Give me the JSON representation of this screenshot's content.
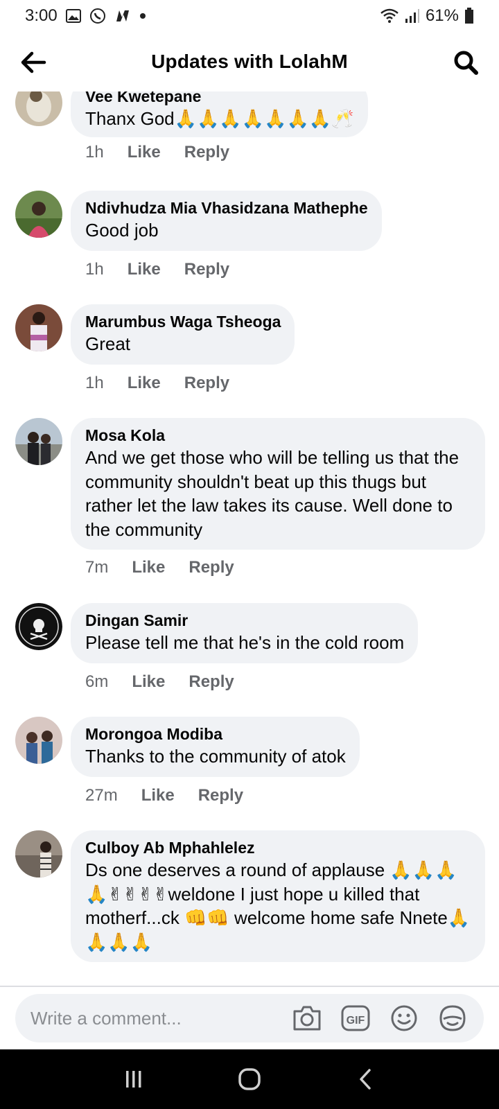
{
  "status_bar": {
    "time": "3:00",
    "battery": "61%"
  },
  "header": {
    "title": "Updates with LolahM"
  },
  "comments": [
    {
      "name": "Vee Kwetepane",
      "text": "Thanx God🙏🙏🙏🙏🙏🙏🙏🥂",
      "time": "1h",
      "like": "Like",
      "reply": "Reply"
    },
    {
      "name": "Ndivhudza Mia Vhasidzana Mathephe",
      "text": "Good job",
      "time": "1h",
      "like": "Like",
      "reply": "Reply"
    },
    {
      "name": "Marumbus Waga Tsheoga",
      "text": "Great",
      "time": "1h",
      "like": "Like",
      "reply": "Reply"
    },
    {
      "name": "Mosa Kola",
      "text": "And we get those who will be telling us that the community shouldn't beat up this thugs but rather let the law takes its cause. Well done to the community",
      "time": "7m",
      "like": "Like",
      "reply": "Reply"
    },
    {
      "name": "Dingan Samir",
      "text": "Please tell me that he's in the cold room",
      "time": "6m",
      "like": "Like",
      "reply": "Reply"
    },
    {
      "name": "Morongoa Modiba",
      "text": "Thanks to the community of atok",
      "time": "27m",
      "like": "Like",
      "reply": "Reply"
    },
    {
      "name": "Culboy Ab Mphahlelez",
      "text": "Ds one deserves a round of applause 🙏🙏🙏🙏✌✌✌✌weldone I just hope u killed that motherf...ck 👊👊 welcome home safe Nnete🙏🙏🙏🙏",
      "time": "",
      "like": "",
      "reply": ""
    }
  ],
  "composer": {
    "placeholder": "Write a comment...",
    "tools": [
      "camera-icon",
      "gif-icon",
      "emoji-icon",
      "sticker-icon"
    ]
  },
  "icons": {
    "back": "back-arrow-icon",
    "search": "search-icon"
  },
  "colors": {
    "bubble": "#f0f2f5",
    "meta": "#65676b",
    "navbar": "#000000"
  }
}
